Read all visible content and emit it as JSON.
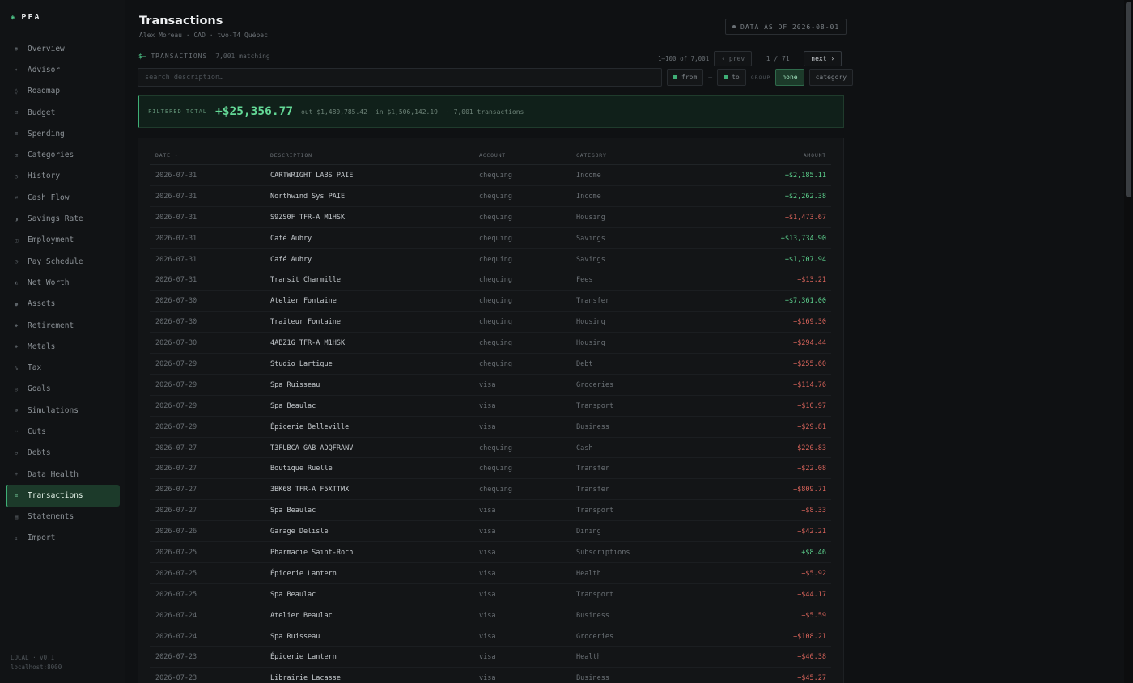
{
  "brand": {
    "name": "PFA"
  },
  "sidebar": {
    "items": [
      {
        "label": "Overview",
        "icon": "◉"
      },
      {
        "label": "Advisor",
        "icon": "✦"
      },
      {
        "label": "Roadmap",
        "icon": "◊"
      },
      {
        "label": "Budget",
        "icon": "⊡"
      },
      {
        "label": "Spending",
        "icon": "≡"
      },
      {
        "label": "Categories",
        "icon": "⊞"
      },
      {
        "label": "History",
        "icon": "◔"
      },
      {
        "label": "Cash Flow",
        "icon": "⇄"
      },
      {
        "label": "Savings Rate",
        "icon": "◑"
      },
      {
        "label": "Employment",
        "icon": "◫"
      },
      {
        "label": "Pay Schedule",
        "icon": "◷"
      },
      {
        "label": "Net Worth",
        "icon": "◭"
      },
      {
        "label": "Assets",
        "icon": "●"
      },
      {
        "label": "Retirement",
        "icon": "◆"
      },
      {
        "label": "Metals",
        "icon": "◈"
      },
      {
        "label": "Tax",
        "icon": "%"
      },
      {
        "label": "Goals",
        "icon": "◎"
      },
      {
        "label": "Simulations",
        "icon": "⊛"
      },
      {
        "label": "Cuts",
        "icon": "✂"
      },
      {
        "label": "Debts",
        "icon": "⊖"
      },
      {
        "label": "Data Health",
        "icon": "+"
      },
      {
        "label": "Transactions",
        "icon": "≡",
        "active": true
      },
      {
        "label": "Statements",
        "icon": "▤"
      },
      {
        "label": "Import",
        "icon": "↥"
      }
    ],
    "footer_line1": "LOCAL · v0.1",
    "footer_line2": "localhost:8000"
  },
  "header": {
    "title": "Transactions",
    "subtitle": "Alex Moreau · CAD · two-T4 Québec",
    "data_as_of": "DATA AS OF 2026-08-01"
  },
  "section": {
    "glyph": "$—",
    "label": "TRANSACTIONS",
    "count": "7,001 matching"
  },
  "pager": {
    "range": "1–100 of 7,001",
    "prev": "‹ prev",
    "page": "1 / 71",
    "next": "next ›"
  },
  "search": {
    "placeholder": "search description…"
  },
  "filters": {
    "from": "from",
    "dash": "—",
    "to": "to",
    "group_label": "GROUP",
    "group_none": "none",
    "group_category": "category"
  },
  "totals": {
    "label": "FILTERED TOTAL",
    "amount": "+$25,356.77",
    "out": "out $1,480,785.42",
    "in": "in $1,506,142.19",
    "count": "· 7,001 transactions"
  },
  "table": {
    "headers": {
      "date": "DATE ▾",
      "description": "DESCRIPTION",
      "account": "ACCOUNT",
      "category": "CATEGORY",
      "amount": "AMOUNT"
    },
    "rows": [
      {
        "date": "2026-07-31",
        "description": "CARTWRIGHT LABS PAIE",
        "account": "chequing",
        "category": "Income",
        "amount": "+$2,185.11",
        "sign": "pos"
      },
      {
        "date": "2026-07-31",
        "description": "Northwind Sys PAIE",
        "account": "chequing",
        "category": "Income",
        "amount": "+$2,262.38",
        "sign": "pos"
      },
      {
        "date": "2026-07-31",
        "description": "S9ZS0F TFR-A M1HSK",
        "account": "chequing",
        "category": "Housing",
        "amount": "−$1,473.67",
        "sign": "neg"
      },
      {
        "date": "2026-07-31",
        "description": "Café Aubry",
        "account": "chequing",
        "category": "Savings",
        "amount": "+$13,734.90",
        "sign": "pos"
      },
      {
        "date": "2026-07-31",
        "description": "Café Aubry",
        "account": "chequing",
        "category": "Savings",
        "amount": "+$1,707.94",
        "sign": "pos"
      },
      {
        "date": "2026-07-31",
        "description": "Transit Charmille",
        "account": "chequing",
        "category": "Fees",
        "amount": "−$13.21",
        "sign": "neg"
      },
      {
        "date": "2026-07-30",
        "description": "Atelier Fontaine",
        "account": "chequing",
        "category": "Transfer",
        "amount": "+$7,361.00",
        "sign": "pos"
      },
      {
        "date": "2026-07-30",
        "description": "Traiteur Fontaine",
        "account": "chequing",
        "category": "Housing",
        "amount": "−$169.30",
        "sign": "neg"
      },
      {
        "date": "2026-07-30",
        "description": "4ABZ1G TFR-A M1HSK",
        "account": "chequing",
        "category": "Housing",
        "amount": "−$294.44",
        "sign": "neg"
      },
      {
        "date": "2026-07-29",
        "description": "Studio Lartigue",
        "account": "chequing",
        "category": "Debt",
        "amount": "−$255.60",
        "sign": "neg"
      },
      {
        "date": "2026-07-29",
        "description": "Spa Ruisseau",
        "account": "visa",
        "category": "Groceries",
        "amount": "−$114.76",
        "sign": "neg"
      },
      {
        "date": "2026-07-29",
        "description": "Spa Beaulac",
        "account": "visa",
        "category": "Transport",
        "amount": "−$10.97",
        "sign": "neg"
      },
      {
        "date": "2026-07-29",
        "description": "Épicerie Belleville",
        "account": "visa",
        "category": "Business",
        "amount": "−$29.81",
        "sign": "neg"
      },
      {
        "date": "2026-07-27",
        "description": "T3FUBCA GAB ADQFRANV",
        "account": "chequing",
        "category": "Cash",
        "amount": "−$220.83",
        "sign": "neg"
      },
      {
        "date": "2026-07-27",
        "description": "Boutique Ruelle",
        "account": "chequing",
        "category": "Transfer",
        "amount": "−$22.08",
        "sign": "neg"
      },
      {
        "date": "2026-07-27",
        "description": "3BK68 TFR-A F5XTTMX",
        "account": "chequing",
        "category": "Transfer",
        "amount": "−$809.71",
        "sign": "neg"
      },
      {
        "date": "2026-07-27",
        "description": "Spa Beaulac",
        "account": "visa",
        "category": "Transport",
        "amount": "−$8.33",
        "sign": "neg"
      },
      {
        "date": "2026-07-26",
        "description": "Garage Delisle",
        "account": "visa",
        "category": "Dining",
        "amount": "−$42.21",
        "sign": "neg"
      },
      {
        "date": "2026-07-25",
        "description": "Pharmacie Saint-Roch",
        "account": "visa",
        "category": "Subscriptions",
        "amount": "+$8.46",
        "sign": "pos"
      },
      {
        "date": "2026-07-25",
        "description": "Épicerie Lantern",
        "account": "visa",
        "category": "Health",
        "amount": "−$5.92",
        "sign": "neg"
      },
      {
        "date": "2026-07-25",
        "description": "Spa Beaulac",
        "account": "visa",
        "category": "Transport",
        "amount": "−$44.17",
        "sign": "neg"
      },
      {
        "date": "2026-07-24",
        "description": "Atelier Beaulac",
        "account": "visa",
        "category": "Business",
        "amount": "−$5.59",
        "sign": "neg"
      },
      {
        "date": "2026-07-24",
        "description": "Spa Ruisseau",
        "account": "visa",
        "category": "Groceries",
        "amount": "−$108.21",
        "sign": "neg"
      },
      {
        "date": "2026-07-23",
        "description": "Épicerie Lantern",
        "account": "visa",
        "category": "Health",
        "amount": "−$40.38",
        "sign": "neg"
      },
      {
        "date": "2026-07-23",
        "description": "Librairie Lacasse",
        "account": "visa",
        "category": "Business",
        "amount": "−$45.27",
        "sign": "neg"
      }
    ]
  },
  "colors": {
    "accent": "#3fae76",
    "positive": "#5ccf8c",
    "negative": "#d7635a",
    "background": "#0f1113"
  }
}
